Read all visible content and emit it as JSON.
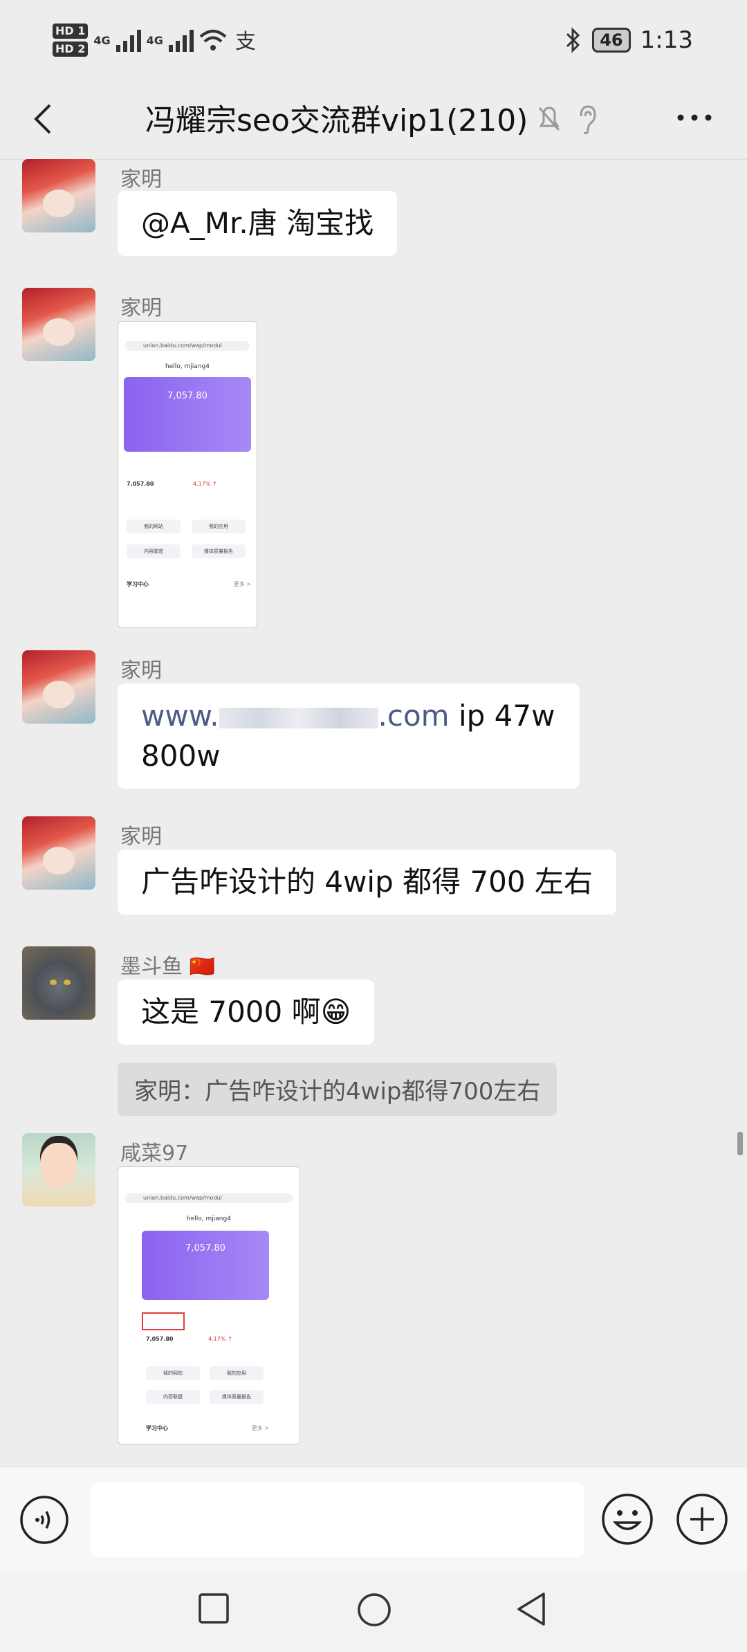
{
  "status_bar": {
    "hd1": "HD 1",
    "hd2": "HD 2",
    "network1": "4G",
    "network2": "4G",
    "battery": "46",
    "time": "1:13"
  },
  "header": {
    "title": "冯耀宗seo交流群vip1(210)"
  },
  "messages": [
    {
      "sender": "家明",
      "text": "@A_Mr.唐  淘宝找"
    },
    {
      "sender": "家明",
      "image": {
        "url": "union.baidu.com/wap/modul",
        "greeting": "hello, mjiang4",
        "amount": "7,057.80",
        "amount2": "7,057.80",
        "pct": "4.17% ↑",
        "btn1": "我的网站",
        "btn2": "我的应用",
        "btn3": "内容联盟",
        "btn4": "媒体质量报告",
        "section": "学习中心",
        "more": "更多 >"
      }
    },
    {
      "sender": "家明",
      "link_prefix": "www.",
      "link_suffix": ".com",
      "text_after": " ip 47w",
      "text_line2": "800w"
    },
    {
      "sender": "家明",
      "text": "广告咋设计的 4wip 都得 700 左右"
    },
    {
      "sender": "墨斗鱼",
      "flag": "🇨🇳",
      "text": "这是 7000 啊",
      "emoji": "😁",
      "quote": "家明：广告咋设计的4wip都得700左右"
    },
    {
      "sender": "咸菜97",
      "image": {
        "url": "union.baidu.com/wap/modul",
        "greeting": "hello, mjiang4",
        "amount": "7,057.80",
        "amount2": "7,057.80",
        "pct": "4.17% ↑",
        "btn1": "我的网站",
        "btn2": "我的应用",
        "btn3": "内容联盟",
        "btn4": "媒体质量报告",
        "section": "学习中心",
        "more": "更多 >"
      }
    }
  ],
  "colors": {
    "background": "#ededed",
    "bubble": "#ffffff",
    "link": "#4a5b86",
    "card": "#8a63f0"
  }
}
